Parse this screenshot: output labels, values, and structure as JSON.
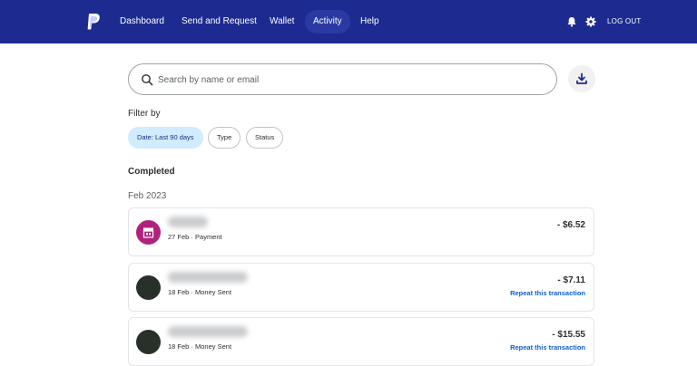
{
  "nav": {
    "items": [
      {
        "label": "Dashboard"
      },
      {
        "label": "Send and Request"
      },
      {
        "label": "Wallet"
      },
      {
        "label": "Activity"
      },
      {
        "label": "Help"
      }
    ],
    "active": "Activity",
    "logout_label": "LOG OUT",
    "icons": [
      "paypal-logo",
      "bell-icon",
      "gear-icon"
    ],
    "colors": {
      "nav_bg": "#1d2b91",
      "active_pill": "#2b3aa3"
    }
  },
  "search": {
    "placeholder": "Search by name or email",
    "value": ""
  },
  "filters": {
    "label": "Filter by",
    "chips": [
      {
        "label": "Date: Last 90 days"
      },
      {
        "label": "Type"
      },
      {
        "label": "Status"
      }
    ]
  },
  "sections": {
    "completed_title": "Completed",
    "month": "Feb 2023"
  },
  "transactions": [
    {
      "meta": "27 Feb · Payment",
      "amount": "- $6.52",
      "repeat": ""
    },
    {
      "meta": "18 Feb · Money Sent",
      "amount": "- $7.11",
      "repeat": "Repeat this transaction"
    },
    {
      "meta": "18 Feb · Money Sent",
      "amount": "- $15.55",
      "repeat": "Repeat this transaction"
    }
  ],
  "colors": {
    "link": "#0e5ec9",
    "selected_chip": "#d1ebff",
    "merchant_avatar": "#b0237d",
    "person_avatar": "#27312a"
  }
}
